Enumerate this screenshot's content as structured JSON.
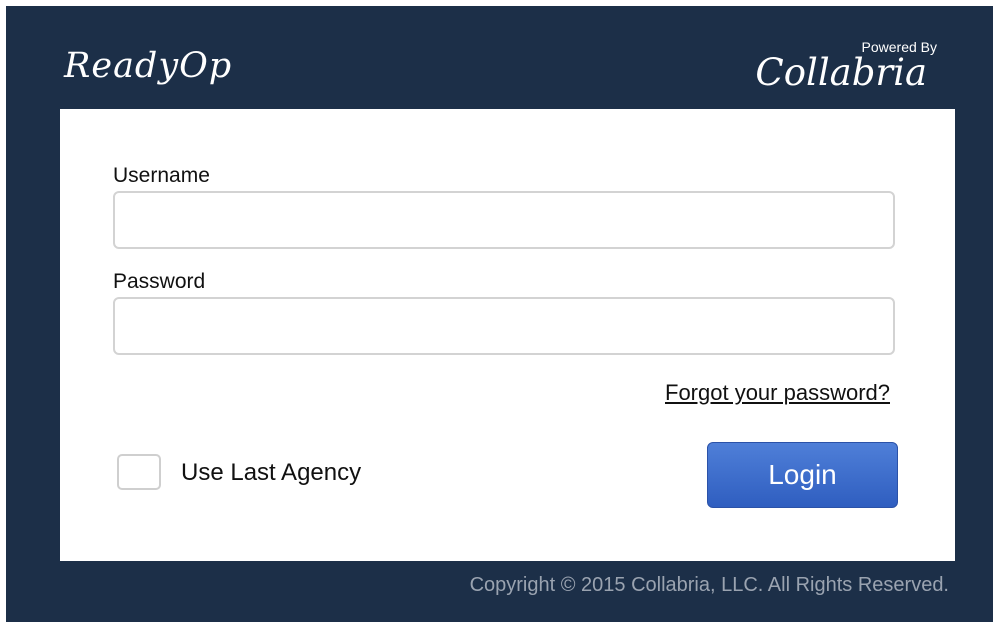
{
  "header": {
    "app_logo": "ReadyOp",
    "powered_by": "Powered By",
    "partner_logo": "Collabria"
  },
  "form": {
    "username_label": "Username",
    "username_value": "",
    "password_label": "Password",
    "password_value": "",
    "forgot_link": "Forgot your password?",
    "remember_label": "Use Last Agency",
    "remember_checked": false,
    "login_label": "Login"
  },
  "footer": {
    "copyright": "Copyright © 2015 Collabria, LLC. All Rights Reserved."
  },
  "colors": {
    "frame_background": "#1c2f48",
    "login_button": "#3a68cc"
  }
}
